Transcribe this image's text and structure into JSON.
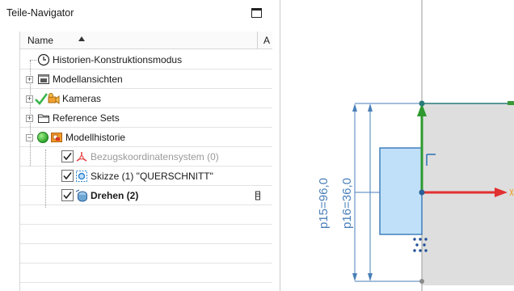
{
  "navigator": {
    "title": "Teile-Navigator",
    "column_name": "Name",
    "column_a": "A",
    "items": [
      {
        "label": "Historien-Konstruktionsmodus",
        "icon": "clock-icon"
      },
      {
        "label": "Modellansichten",
        "icon": "model-views-icon",
        "expander": "+"
      },
      {
        "label": "Kameras",
        "icon": "cameras-icon",
        "expander": "+"
      },
      {
        "label": "Reference Sets",
        "icon": "folder-icon",
        "expander": "+"
      },
      {
        "label": "Modellhistorie",
        "icon": "model-history-icon",
        "expander": "−"
      },
      {
        "label": "Bezugskoordinatensystem (0)",
        "icon": "datum-csys-icon",
        "checked": true,
        "muted": true
      },
      {
        "label": "Skizze (1) \"QUERSCHNITT\"",
        "icon": "sketch-icon",
        "checked": true
      },
      {
        "label": "Drehen (2)",
        "icon": "revolve-icon",
        "checked": true,
        "bold": true
      }
    ]
  },
  "canvas": {
    "dimension_p15": "p15=96,0",
    "dimension_p16": "p16=36,0",
    "colors": {
      "dimension": "#4a7fb8",
      "x_axis": "#e23030",
      "y_axis": "#2e9a2e",
      "sketch_fill": "#bfe0f8",
      "sketch_stroke": "#2a6fb4",
      "body_fill": "#dedede"
    }
  }
}
